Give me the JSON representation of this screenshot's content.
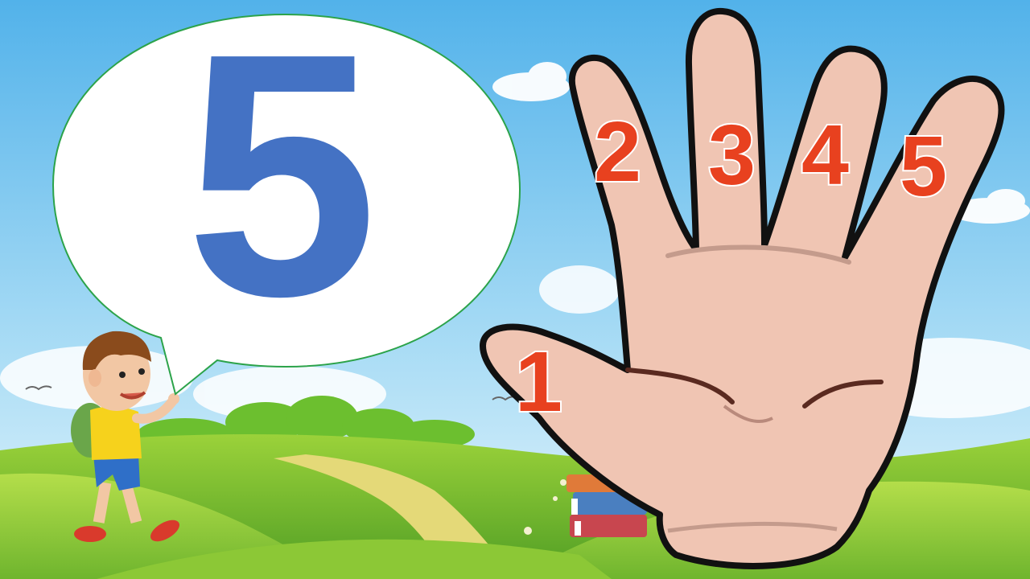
{
  "speech_bubble": {
    "number": "5"
  },
  "fingers": {
    "thumb": "1",
    "index": "2",
    "middle": "3",
    "ring": "4",
    "pinky": "5"
  },
  "colors": {
    "sky_top": "#52b2ea",
    "sky_bottom": "#d8f0fb",
    "grass_light": "#9fd338",
    "grass_dark": "#5fae2a",
    "bubble_outline": "#2ca34a",
    "number_blue": "#4472c4",
    "finger_label_red": "#e8411f",
    "hand_skin": "#f0c5b3",
    "hand_outline": "#111111"
  }
}
